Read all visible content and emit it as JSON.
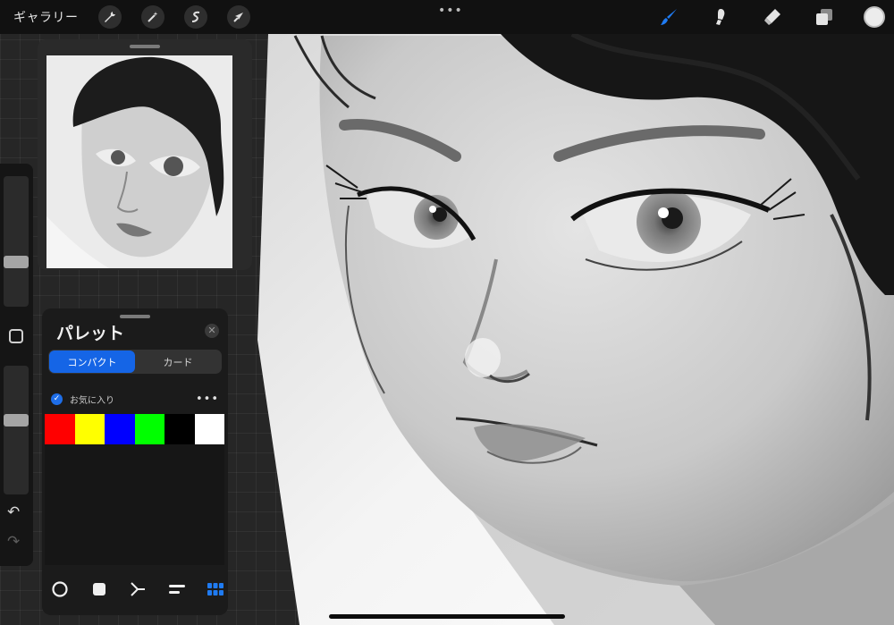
{
  "topbar": {
    "gallery_label": "ギャラリー",
    "advanced_tools": [
      "wrench-icon",
      "magic-wand-icon",
      "selection-icon",
      "transform-arrow-icon"
    ],
    "more_label": "•••",
    "right_tools": [
      "brush-icon",
      "smudge-icon",
      "eraser-icon",
      "layers-icon"
    ],
    "active_tool": "brush-icon",
    "accent_color": "#1f7bf2",
    "current_color": "#ececec"
  },
  "sidebar": {
    "brush_size_level": 0.65,
    "opacity_level": 0.4,
    "undo_icon": "↶",
    "redo_icon": "↷"
  },
  "palette": {
    "title": "パレット",
    "close_icon": "✕",
    "tabs": [
      {
        "label": "コンパクト",
        "active": true
      },
      {
        "label": "カード",
        "active": false
      }
    ],
    "default_palette": {
      "name": "お気に入り",
      "check": "✓",
      "more": "•••",
      "colors": [
        "#ff0000",
        "#ffff00",
        "#0000ff",
        "#00ff00",
        "#000000",
        "#ffffff"
      ]
    },
    "bottom_tabs": [
      "disc-icon",
      "square-icon",
      "harmony-icon",
      "value-sliders-icon",
      "palettes-grid-icon"
    ],
    "active_bottom_tab": "palettes-grid-icon"
  }
}
